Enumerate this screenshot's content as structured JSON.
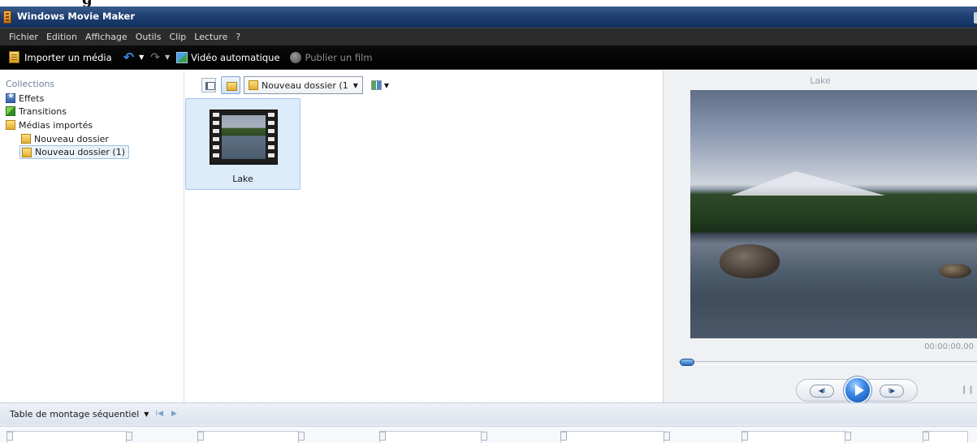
{
  "window": {
    "title": "Windows Movie Maker"
  },
  "menu": [
    "Fichier",
    "Edition",
    "Affichage",
    "Outils",
    "Clip",
    "Lecture",
    "?"
  ],
  "toolbar": {
    "import_label": "Importer un média",
    "auto_video_label": "Vidéo automatique",
    "publish_label": "Publier un film"
  },
  "collections": {
    "header": "Collections",
    "items": [
      {
        "label": "Effets",
        "icon": "effects-icon"
      },
      {
        "label": "Transitions",
        "icon": "transitions-icon"
      },
      {
        "label": "Médias importés",
        "icon": "folder-icon"
      },
      {
        "label": "Nouveau dossier",
        "icon": "folder-icon"
      },
      {
        "label": "Nouveau dossier (1)",
        "icon": "folder-icon",
        "selected": true
      }
    ]
  },
  "contents": {
    "folder_select": "Nouveau dossier (1",
    "clips": [
      {
        "label": "Lake"
      }
    ]
  },
  "preview": {
    "title": "Lake",
    "time": "00:00:00,00"
  },
  "storyboard": {
    "title": "Table de montage séquentiel"
  },
  "colors": {
    "titlebar": "#1f3f72",
    "toolbar": "#000000",
    "selection": "#dcebfa",
    "accent": "#3c8ae6"
  }
}
